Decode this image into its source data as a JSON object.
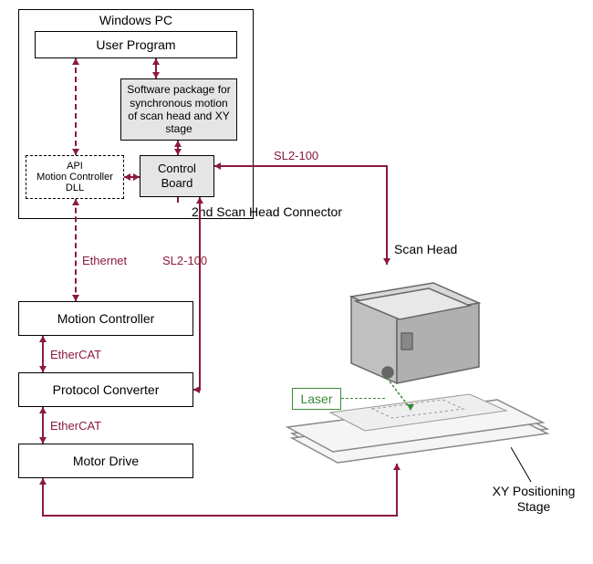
{
  "pc_title": "Windows PC",
  "user_program": "User Program",
  "software_pkg": "Software package for synchronous motion of scan head and XY stage",
  "api_top": "API",
  "motion_ctrl_dll": "Motion Controller",
  "dll": "DLL",
  "control_board": "Control Board",
  "ethernet": "Ethernet",
  "motion_controller": "Motion Controller",
  "ethercat1": "EtherCAT",
  "protocol_conv": "Protocol Converter",
  "ethercat2": "EtherCAT",
  "motor_drive": "Motor Drive",
  "sl2_1": "SL2-100",
  "sl2_2": "SL2-100",
  "scan_head_conn": "2nd Scan Head Connector",
  "scan_head": "Scan Head",
  "laser": "Laser",
  "xy_stage": "XY Positioning Stage"
}
